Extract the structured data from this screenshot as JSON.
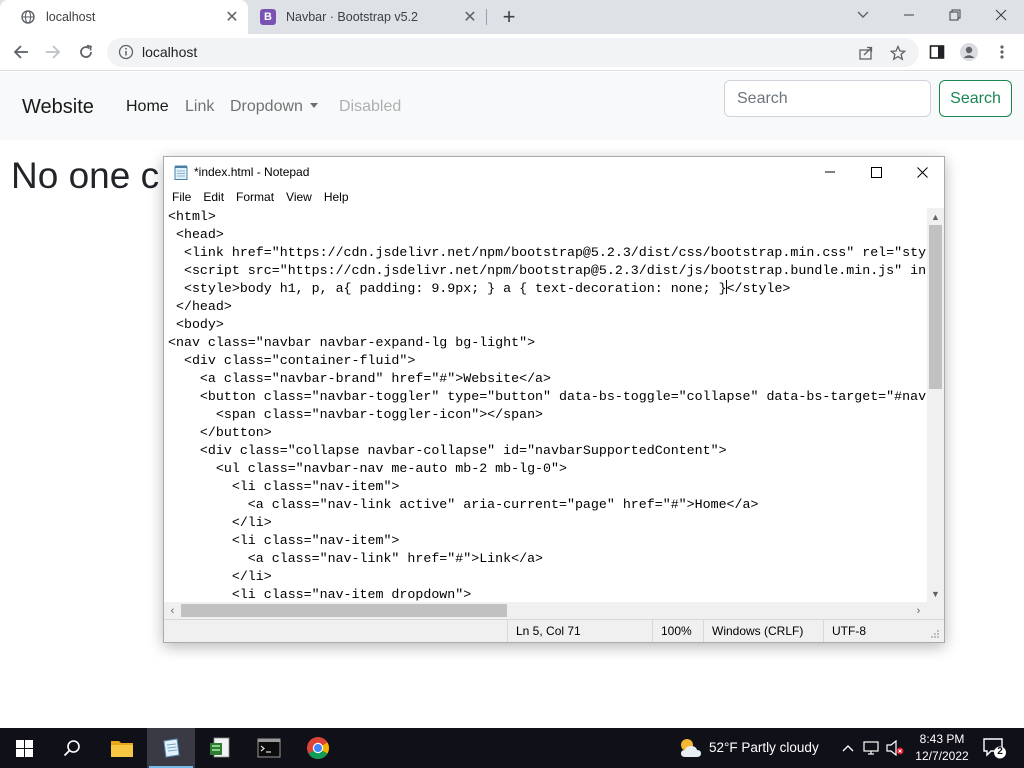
{
  "browser": {
    "tabs": [
      {
        "title": "localhost",
        "active": true
      },
      {
        "title": "Navbar · Bootstrap v5.2",
        "active": false
      }
    ],
    "address": "localhost"
  },
  "website": {
    "brand": "Website",
    "nav_links": [
      "Home",
      "Link",
      "Dropdown",
      "Disabled"
    ],
    "search_placeholder": "Search",
    "search_button": "Search",
    "heading_visible": "No one c"
  },
  "notepad": {
    "title": "*index.html - Notepad",
    "menu": [
      "File",
      "Edit",
      "Format",
      "View",
      "Help"
    ],
    "lines": [
      "<html>",
      " <head>",
      "  <link href=\"https://cdn.jsdelivr.net/npm/bootstrap@5.2.3/dist/css/bootstrap.min.css\" rel=\"sty",
      "  <script src=\"https://cdn.jsdelivr.net/npm/bootstrap@5.2.3/dist/js/bootstrap.bundle.min.js\" in",
      "  <style>body h1, p, a{ padding: 9.9px; } a { text-decoration: none; }</style>",
      " </head>",
      " <body>",
      "<nav class=\"navbar navbar-expand-lg bg-light\">",
      "  <div class=\"container-fluid\">",
      "    <a class=\"navbar-brand\" href=\"#\">Website</a>",
      "    <button class=\"navbar-toggler\" type=\"button\" data-bs-toggle=\"collapse\" data-bs-target=\"#nav",
      "      <span class=\"navbar-toggler-icon\"></span>",
      "    </button>",
      "    <div class=\"collapse navbar-collapse\" id=\"navbarSupportedContent\">",
      "      <ul class=\"navbar-nav me-auto mb-2 mb-lg-0\">",
      "        <li class=\"nav-item\">",
      "          <a class=\"nav-link active\" aria-current=\"page\" href=\"#\">Home</a>",
      "        </li>",
      "        <li class=\"nav-item\">",
      "          <a class=\"nav-link\" href=\"#\">Link</a>",
      "        </li>",
      "        <li class=\"nav-item dropdown\">"
    ],
    "status": {
      "position": "Ln 5, Col 71",
      "zoom": "100%",
      "line_ending": "Windows (CRLF)",
      "encoding": "UTF-8"
    }
  },
  "taskbar": {
    "weather": "52°F  Partly cloudy",
    "time": "8:43 PM",
    "date": "12/7/2022",
    "notification_count": "2"
  }
}
